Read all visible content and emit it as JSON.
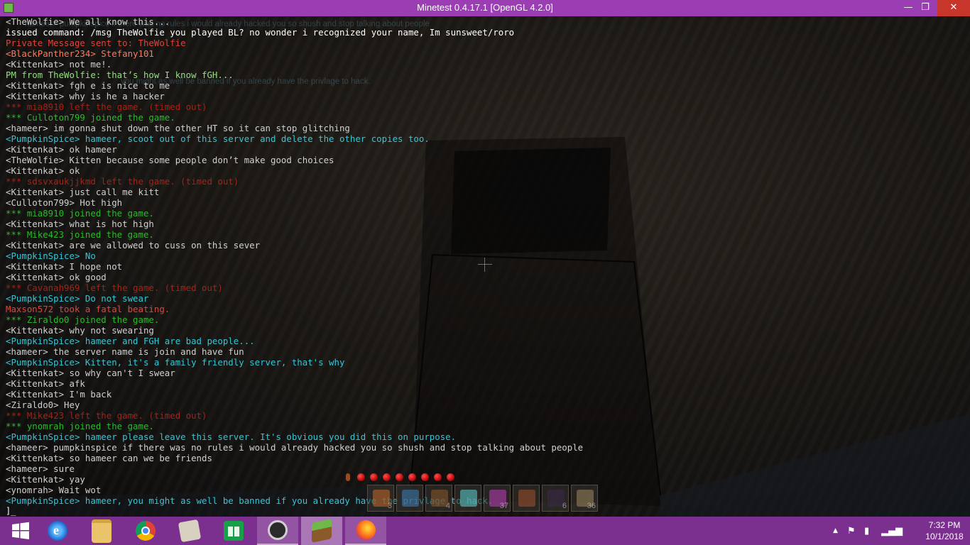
{
  "window": {
    "title": "Minetest 0.4.17.1 [OpenGL 4.2.0]",
    "minimize_glyph": "—",
    "maximize_glyph": "❐",
    "close_glyph": "✕"
  },
  "ghost_hints": [
    "hameer> pumpkinspice if there was no rules i would already hacked you so shush and stop talking about people",
    "you might as well be banned if you already have the privlage to hack."
  ],
  "chat": [
    {
      "text": "<TheWolfie> We all know this...",
      "color": "#d0d0d0"
    },
    {
      "text": "issued command: /msg TheWolfie you played BL? no wonder i recognized your name, Im sunsweet/roro",
      "color": "#ffffff"
    },
    {
      "text": "Private Message sent to: TheWolfie",
      "color": "#e0443a"
    },
    {
      "text": "<BlackPanther234> Stefany101",
      "color": "#ff7a5c"
    },
    {
      "text": "<Kittenkat> not me!.",
      "color": "#d0d0d0"
    },
    {
      "text": "PM from TheWolfie: that’s how I know fGH...",
      "color": "#8fe37a"
    },
    {
      "text": "<Kittenkat> fgh e is nice to me",
      "color": "#d0d0d0"
    },
    {
      "text": "<Kittenkat> why is he a hacker",
      "color": "#d0d0d0"
    },
    {
      "text": "*** mia8910 left the game. (timed out)",
      "color": "#a02418"
    },
    {
      "text": "*** Culloton799 joined the game.",
      "color": "#2eb82e"
    },
    {
      "text": "<hameer> im gonna shut down the other HT so it can stop glitching",
      "color": "#d0d0d0"
    },
    {
      "text": "<PumpkinSpice> hameer, scoot out of this server and delete the other copies too.",
      "color": "#33c6d6"
    },
    {
      "text": "<Kittenkat> ok hameer",
      "color": "#d0d0d0"
    },
    {
      "text": "<TheWolfie> Kitten because some people don’t make good choices",
      "color": "#d0d0d0"
    },
    {
      "text": "<Kittenkat> ok",
      "color": "#d0d0d0"
    },
    {
      "text": "*** sdsvxaukjjkmd left the game. (timed out)",
      "color": "#a02418"
    },
    {
      "text": "<Kittenkat> just call me kitt",
      "color": "#d0d0d0"
    },
    {
      "text": "<Culloton799> Hot high",
      "color": "#d0d0d0"
    },
    {
      "text": "*** mia8910 joined the game.",
      "color": "#2eb82e"
    },
    {
      "text": "<Kittenkat> what is hot high",
      "color": "#d0d0d0"
    },
    {
      "text": "*** Mike423 joined the game.",
      "color": "#2eb82e"
    },
    {
      "text": "<Kittenkat> are we allowed to cuss on this sever",
      "color": "#d0d0d0"
    },
    {
      "text": "<PumpkinSpice> No",
      "color": "#33c6d6"
    },
    {
      "text": "<Kittenkat> I hope not",
      "color": "#d0d0d0"
    },
    {
      "text": "<Kittenkat> ok good",
      "color": "#d0d0d0"
    },
    {
      "text": "*** Cavanah969 left the game. (timed out)",
      "color": "#a02418"
    },
    {
      "text": "<PumpkinSpice> Do not swear",
      "color": "#33c6d6"
    },
    {
      "text": "Maxson572 took a fatal beating.",
      "color": "#e0443a"
    },
    {
      "text": "*** Ziraldo0 joined the game.",
      "color": "#2eb82e"
    },
    {
      "text": "<Kittenkat> why not swearing",
      "color": "#d0d0d0"
    },
    {
      "text": "<PumpkinSpice> hameer and FGH are bad people...",
      "color": "#33c6d6"
    },
    {
      "text": "<hameer> the server name is join and have fun",
      "color": "#d0d0d0"
    },
    {
      "text": "<PumpkinSpice> Kitten, it's a family friendly server, that's why",
      "color": "#33c6d6"
    },
    {
      "text": "<Kittenkat> so why can't I swear",
      "color": "#d0d0d0"
    },
    {
      "text": "<Kittenkat> afk",
      "color": "#d0d0d0"
    },
    {
      "text": "<Kittenkat> I'm back",
      "color": "#d0d0d0"
    },
    {
      "text": "<Ziraldo0> Hey",
      "color": "#d0d0d0"
    },
    {
      "text": "*** Mike423 left the game. (timed out)",
      "color": "#a02418"
    },
    {
      "text": "*** ynomrah joined the game.",
      "color": "#2eb82e"
    },
    {
      "text": "<PumpkinSpice> hameer please leave this server. It's obvious you did this on purpose.",
      "color": "#33c6d6"
    },
    {
      "text": "<hameer> pumpkinspice if there was no rules i would already hacked you so shush and stop talking about people",
      "color": "#d0d0d0"
    },
    {
      "text": "<Kittenkat> so hameer can we be friends",
      "color": "#d0d0d0"
    },
    {
      "text": "<hameer> sure",
      "color": "#d0d0d0"
    },
    {
      "text": "<Kittenkat> yay",
      "color": "#d0d0d0"
    },
    {
      "text": "<ynomrah> Wait wot",
      "color": "#d0d0d0"
    },
    {
      "text": "<PumpkinSpice> hameer, you might as well be banned if you already have the privlage to hack.",
      "color": "#33c6d6"
    }
  ],
  "console_prompt": "]_",
  "hud": {
    "hearts": 8,
    "hotbar": [
      {
        "icon": "orange-item-icon",
        "color": "#c7692a",
        "count": "3"
      },
      {
        "icon": "blue-tool-icon",
        "color": "#3d7fb8",
        "count": ""
      },
      {
        "icon": "bookshelf-icon",
        "color": "#8a5a2b",
        "count": "4"
      },
      {
        "icon": "diamond-block-icon",
        "color": "#5fd6d6",
        "count": ""
      },
      {
        "icon": "rainbow-block-icon",
        "color": "#c040c0",
        "count": "37"
      },
      {
        "icon": "bow-icon",
        "color": "#a0522d",
        "count": ""
      },
      {
        "icon": "obsidian-block-icon",
        "color": "#3a2a4a",
        "count": "6"
      },
      {
        "icon": "wood-slab-icon",
        "color": "#9c8860",
        "count": "36"
      }
    ]
  },
  "taskbar": {
    "apps": [
      {
        "name": "start-button",
        "icon": "windows-icon",
        "color": "#ffffff"
      },
      {
        "name": "internet-explorer",
        "icon": "ie-icon",
        "color": "#2a8ee6"
      },
      {
        "name": "file-explorer",
        "icon": "folder-icon",
        "color": "#e9c46a"
      },
      {
        "name": "chrome",
        "icon": "chrome-icon",
        "color": "#e8a020"
      },
      {
        "name": "paint-app",
        "icon": "paint-icon",
        "color": "#d8d0c0"
      },
      {
        "name": "store",
        "icon": "store-icon",
        "color": "#18a048"
      },
      {
        "name": "game-app",
        "icon": "bo-icon",
        "color": "#d0d0d0"
      },
      {
        "name": "minetest",
        "icon": "minetest-icon",
        "color": "#6fb94a"
      },
      {
        "name": "firefox",
        "icon": "firefox-icon",
        "color": "#ff7a1a"
      }
    ],
    "time": "7:32 PM",
    "date": "10/1/2018"
  }
}
